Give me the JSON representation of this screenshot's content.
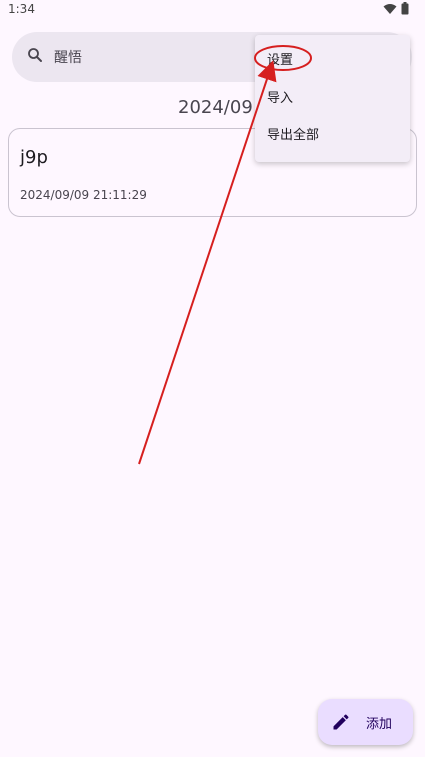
{
  "status_bar": {
    "time": "1:34",
    "icons": [
      "wifi-icon",
      "battery-icon"
    ]
  },
  "search": {
    "icon": "search-icon",
    "text": "醒悟"
  },
  "date_header": "2024/09",
  "notes": [
    {
      "title": "j9p",
      "timestamp": "2024/09/09 21:11:29"
    }
  ],
  "menu": {
    "items": [
      {
        "label": "设置"
      },
      {
        "label": "导入"
      },
      {
        "label": "导出全部"
      }
    ],
    "highlighted": "设置"
  },
  "fab": {
    "icon": "pencil-icon",
    "label": "添加"
  },
  "colors": {
    "background": "#FEF7FF",
    "search_bg": "#ECE6F0",
    "menu_bg": "#F3EDF7",
    "fab_bg": "#EADDFF",
    "annotation": "#D61F1F"
  }
}
